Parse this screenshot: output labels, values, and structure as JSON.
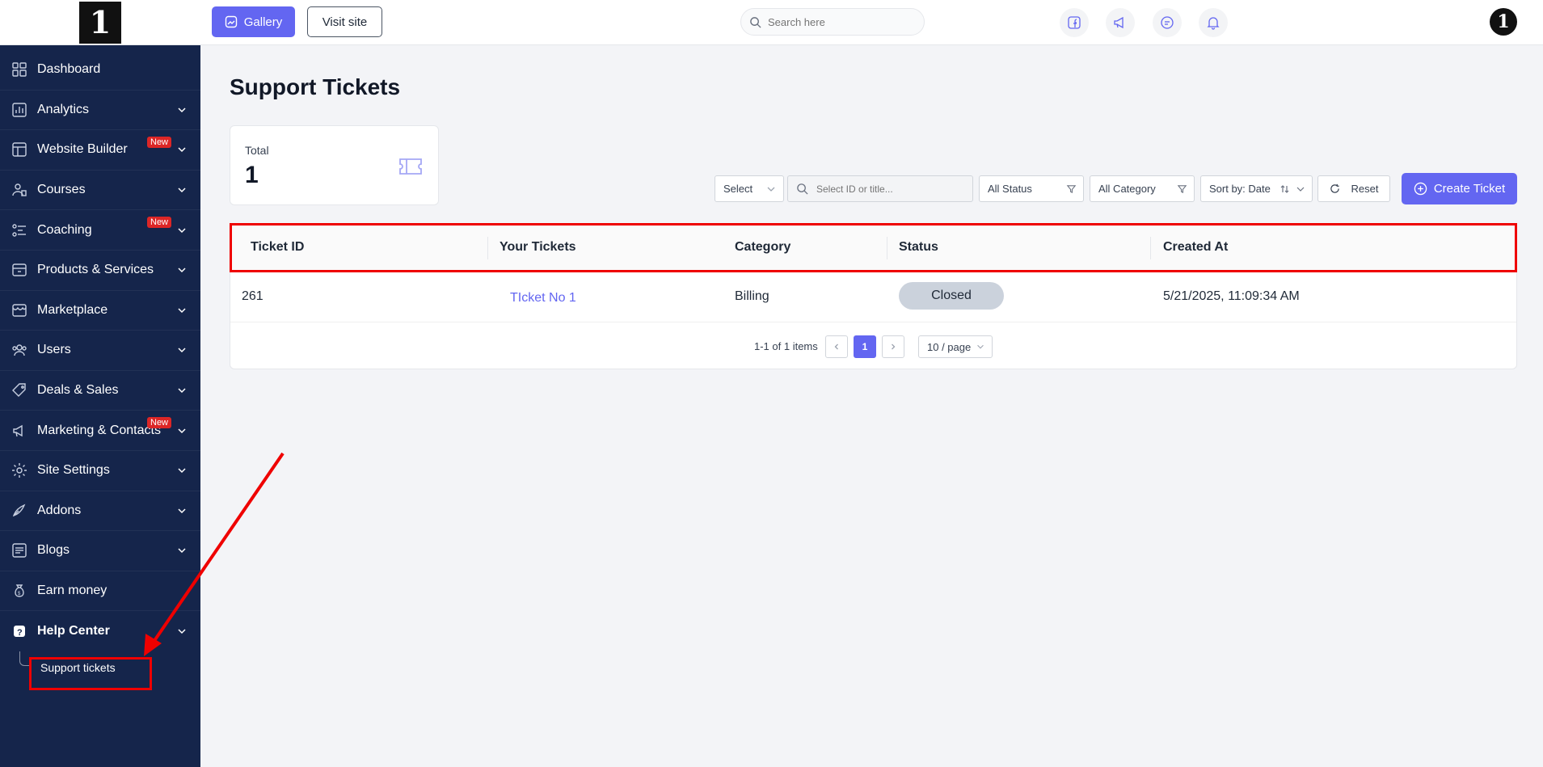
{
  "logo_text": "1",
  "sidebar": {
    "items": [
      {
        "label": "Dashboard",
        "icon": "dashboard-icon",
        "chevron": false
      },
      {
        "label": "Analytics",
        "icon": "analytics-icon",
        "chevron": true
      },
      {
        "label": "Website Builder",
        "icon": "website-builder-icon",
        "chevron": true,
        "badge": "New"
      },
      {
        "label": "Courses",
        "icon": "courses-icon",
        "chevron": true
      },
      {
        "label": "Coaching",
        "icon": "coaching-icon",
        "chevron": true,
        "badge": "New"
      },
      {
        "label": "Products & Services",
        "icon": "products-icon",
        "chevron": true
      },
      {
        "label": "Marketplace",
        "icon": "marketplace-icon",
        "chevron": true
      },
      {
        "label": "Users",
        "icon": "users-icon",
        "chevron": true
      },
      {
        "label": "Deals & Sales",
        "icon": "deals-icon",
        "chevron": true
      },
      {
        "label": "Marketing & Contacts",
        "icon": "megaphone-icon",
        "chevron": true,
        "badge": "New"
      },
      {
        "label": "Site Settings",
        "icon": "gear-icon",
        "chevron": true
      },
      {
        "label": "Addons",
        "icon": "addons-icon",
        "chevron": true
      },
      {
        "label": "Blogs",
        "icon": "blogs-icon",
        "chevron": true
      },
      {
        "label": "Earn money",
        "icon": "money-bag-icon",
        "chevron": false
      },
      {
        "label": "Help Center",
        "icon": "help-icon",
        "chevron": true,
        "active": true
      }
    ],
    "sub_item": "Support tickets"
  },
  "topbar": {
    "gallery_label": "Gallery",
    "visit_label": "Visit site",
    "search_placeholder": "Search here",
    "avatar_text": "1"
  },
  "main": {
    "title": "Support Tickets",
    "stat": {
      "label": "Total",
      "value": "1"
    },
    "filters": {
      "select_label": "Select",
      "search_placeholder": "Select ID or title...",
      "status_label": "All Status",
      "category_label": "All Category",
      "sort_label": "Sort by: Date",
      "reset_label": "Reset",
      "create_label": "Create Ticket"
    },
    "table": {
      "headers": [
        "Ticket ID",
        "Your Tickets",
        "Category",
        "Status",
        "Created At"
      ],
      "rows": [
        {
          "id": "261",
          "title": "TIcket No 1",
          "category": "Billing",
          "status": "Closed",
          "created": "5/21/2025, 11:09:34 AM"
        }
      ]
    },
    "pagination": {
      "summary": "1-1 of 1 items",
      "current_page": "1",
      "page_size": "10 / page"
    }
  },
  "colors": {
    "sidebar_bg": "#15254b",
    "accent": "#6366f1",
    "annotation_red": "#ef0000",
    "badge_red": "#dc2626"
  }
}
